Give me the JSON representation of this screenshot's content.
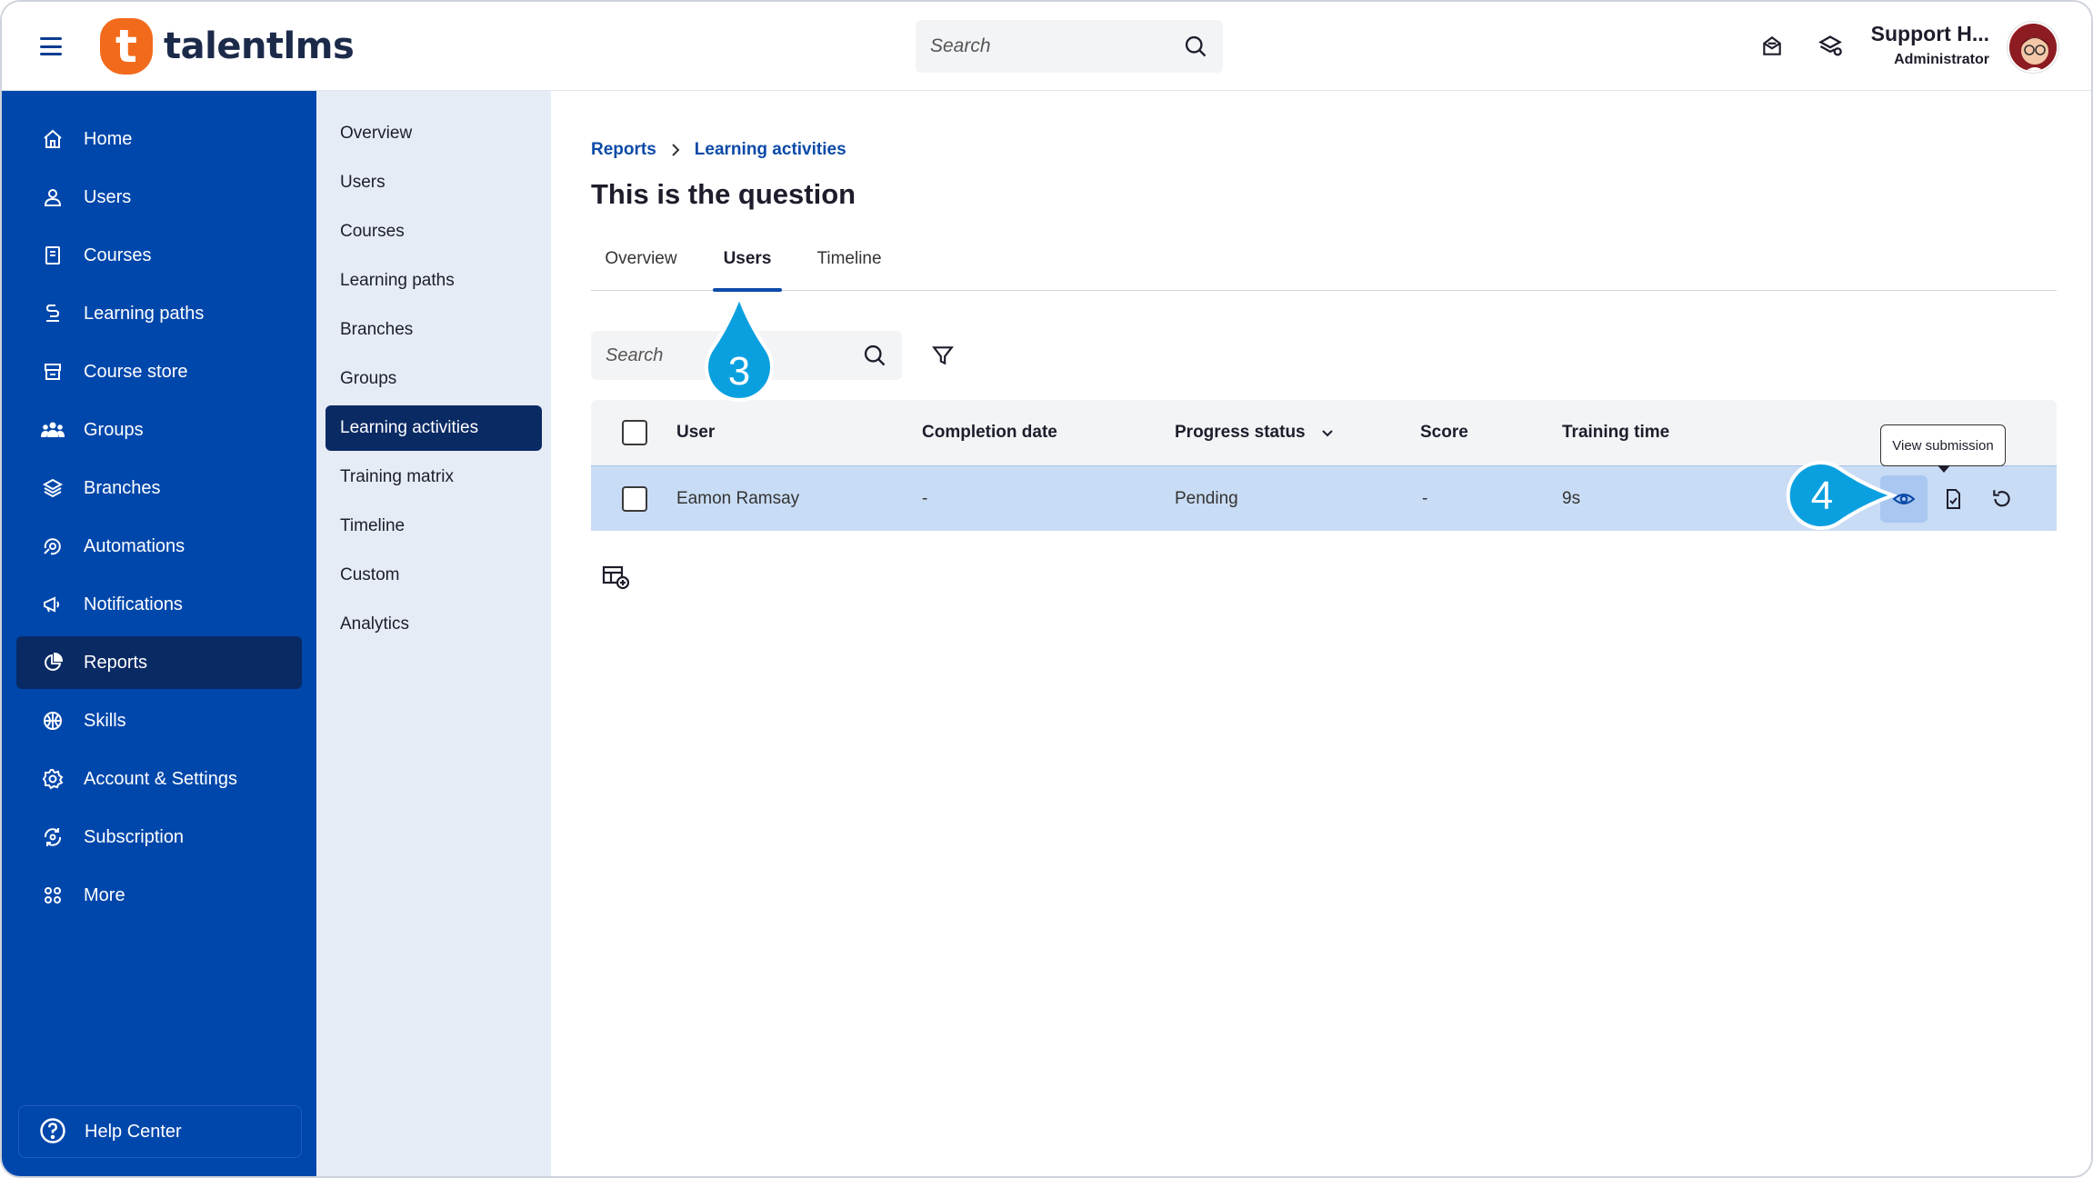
{
  "brand": {
    "logo_letter": "t",
    "name": "talentlms"
  },
  "header": {
    "search_placeholder": "Search",
    "user_name": "Support H...",
    "user_role": "Administrator"
  },
  "sidebar": {
    "items": [
      {
        "label": "Home",
        "icon": "home-icon"
      },
      {
        "label": "Users",
        "icon": "user-icon"
      },
      {
        "label": "Courses",
        "icon": "book-icon"
      },
      {
        "label": "Learning paths",
        "icon": "path-icon"
      },
      {
        "label": "Course store",
        "icon": "store-icon"
      },
      {
        "label": "Groups",
        "icon": "groups-icon"
      },
      {
        "label": "Branches",
        "icon": "layers-icon"
      },
      {
        "label": "Automations",
        "icon": "automation-icon"
      },
      {
        "label": "Notifications",
        "icon": "megaphone-icon"
      },
      {
        "label": "Reports",
        "icon": "pie-chart-icon",
        "active": true
      },
      {
        "label": "Skills",
        "icon": "skills-icon"
      },
      {
        "label": "Account & Settings",
        "icon": "gear-icon"
      },
      {
        "label": "Subscription",
        "icon": "subscription-icon"
      },
      {
        "label": "More",
        "icon": "grid-icon"
      }
    ],
    "help_label": "Help Center"
  },
  "subnav": {
    "items": [
      "Overview",
      "Users",
      "Courses",
      "Learning paths",
      "Branches",
      "Groups",
      "Learning activities",
      "Training matrix",
      "Timeline",
      "Custom",
      "Analytics"
    ],
    "active": "Learning activities"
  },
  "breadcrumb": {
    "root": "Reports",
    "current": "Learning activities"
  },
  "page_title": "This is the question",
  "tabs": [
    "Overview",
    "Users",
    "Timeline"
  ],
  "active_tab": "Users",
  "table_search_placeholder": "Search",
  "table": {
    "columns": [
      "User",
      "Completion date",
      "Progress status",
      "Score",
      "Training time"
    ],
    "rows": [
      {
        "user": "Eamon Ramsay",
        "completion_date": "-",
        "progress_status": "Pending",
        "score": "-",
        "training_time": "9s"
      }
    ]
  },
  "tooltip": "View submission",
  "markers": {
    "step_a": "3",
    "step_b": "4"
  },
  "colors": {
    "primary": "#0047ab",
    "active_nav": "#0a2a64",
    "accent_orange": "#f26b1d",
    "marker": "#0aa0e0",
    "row_highlight": "#c9dcf5"
  }
}
